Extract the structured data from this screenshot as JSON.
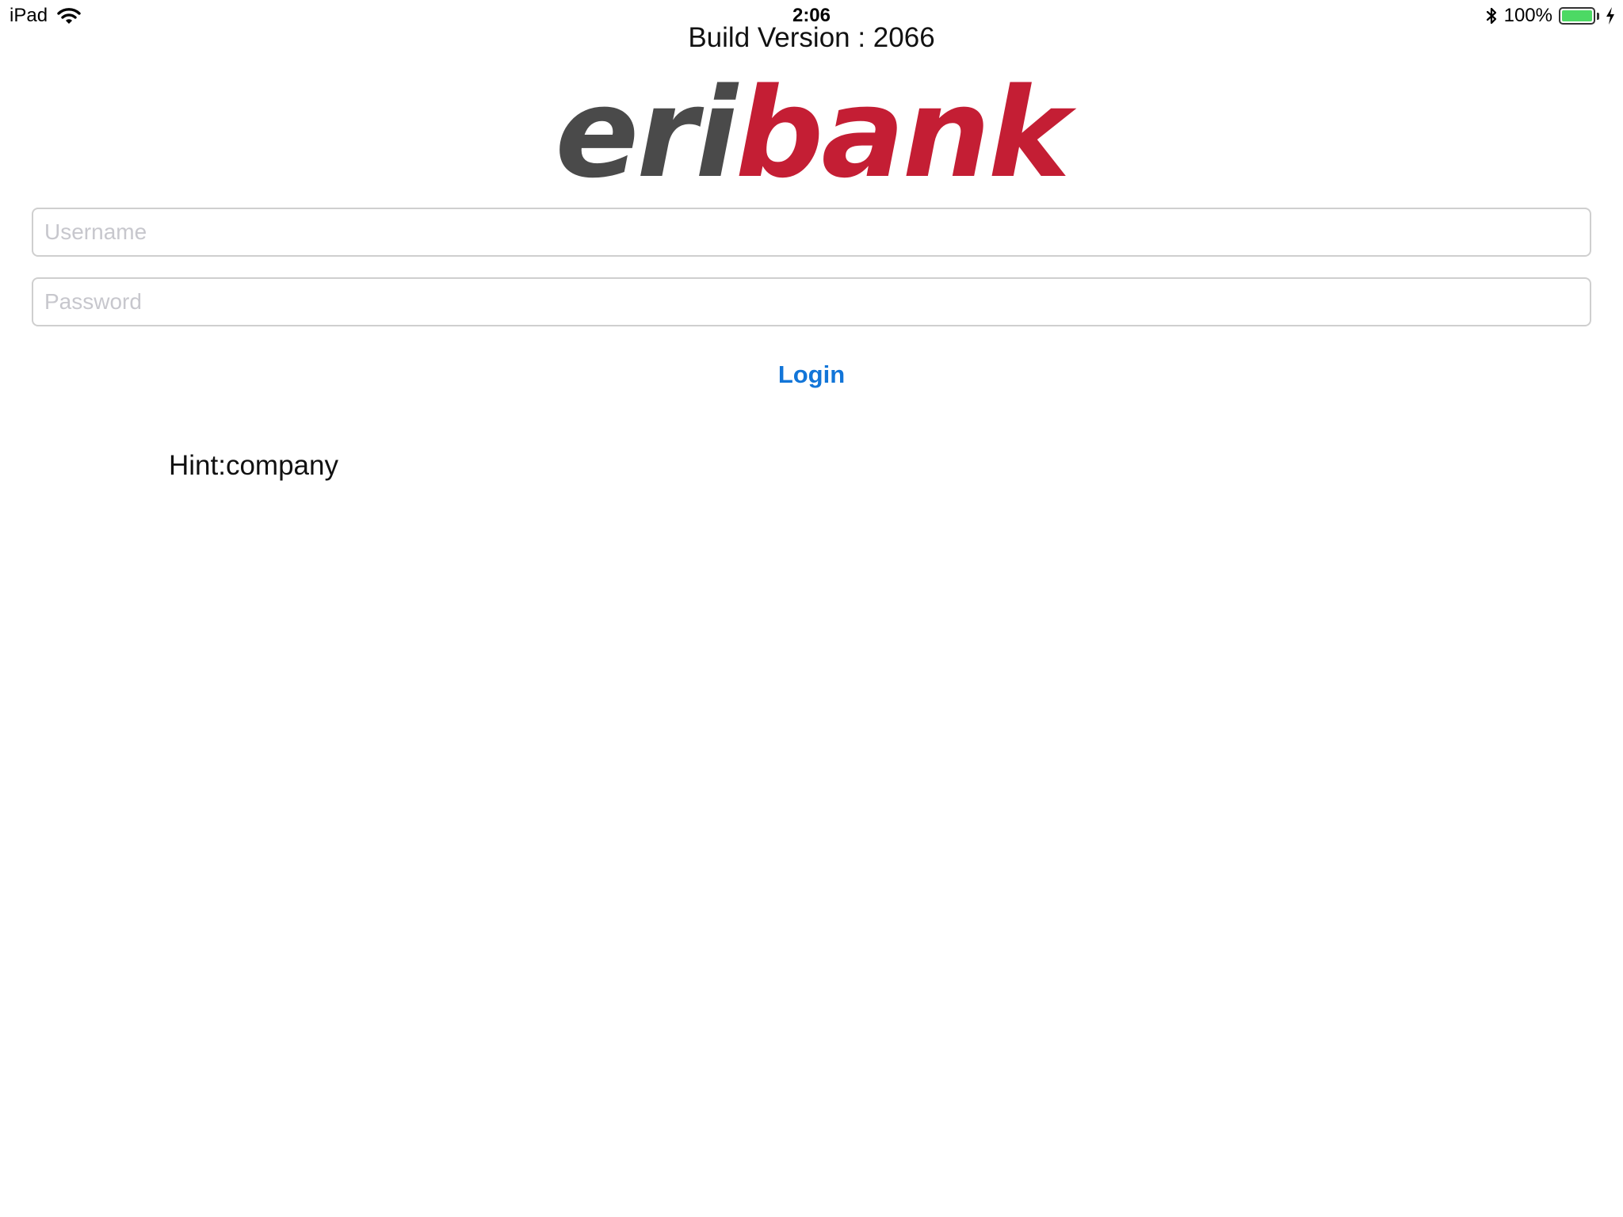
{
  "status_bar": {
    "device": "iPad",
    "time": "2:06",
    "battery_percent": "100%",
    "battery_level": 1.0,
    "icons": [
      "wifi-icon",
      "bluetooth-icon",
      "battery-icon",
      "charging-bolt-icon"
    ]
  },
  "header": {
    "build_version": "Build Version : 2066"
  },
  "logo": {
    "part1": "eri",
    "part2": "bank",
    "colors": {
      "part1": "#4a4a4a",
      "part2": "#c41e34"
    }
  },
  "form": {
    "username_placeholder": "Username",
    "password_placeholder": "Password",
    "username_value": "",
    "password_value": "",
    "login_label": "Login"
  },
  "hint": "Hint:company",
  "colors": {
    "accent": "#1275d8",
    "battery_fill": "#4cd964"
  }
}
